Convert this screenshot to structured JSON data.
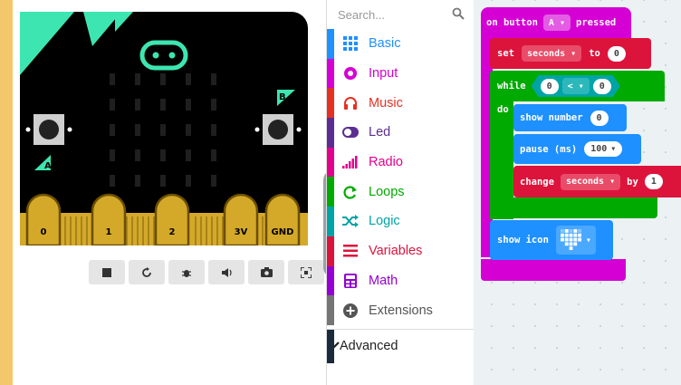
{
  "board": {
    "button_a": "A",
    "button_b": "B",
    "pins": [
      "0",
      "1",
      "2",
      "3V",
      "GND"
    ]
  },
  "sim_toolbar": {
    "buttons": [
      "stop-icon",
      "restart-icon",
      "debug-icon",
      "mute-icon",
      "screenshot-icon",
      "fullscreen-icon"
    ]
  },
  "search": {
    "placeholder": "Search..."
  },
  "categories": [
    {
      "label": "Basic",
      "color": "#1e90ff"
    },
    {
      "label": "Input",
      "color": "#d400d4"
    },
    {
      "label": "Music",
      "color": "#e63022"
    },
    {
      "label": "Led",
      "color": "#5c2d91"
    },
    {
      "label": "Radio",
      "color": "#e3008c"
    },
    {
      "label": "Loops",
      "color": "#00aa00"
    },
    {
      "label": "Logic",
      "color": "#00a4a6"
    },
    {
      "label": "Variables",
      "color": "#dc143c"
    },
    {
      "label": "Math",
      "color": "#9400d3"
    },
    {
      "label": "Extensions",
      "color": "#757575"
    }
  ],
  "advanced": {
    "label": "Advanced"
  },
  "blocks": {
    "on_button": {
      "prefix": "on button",
      "button": "A",
      "suffix": "pressed"
    },
    "set": {
      "prefix": "set",
      "variable": "seconds",
      "to": "to",
      "value": "0"
    },
    "while": {
      "label": "while",
      "left": "0",
      "op": "<",
      "right": "0",
      "do": "do"
    },
    "show_number": {
      "label": "show number",
      "value": "0"
    },
    "pause": {
      "label": "pause (ms)",
      "value": "100"
    },
    "change": {
      "label": "change",
      "variable": "seconds",
      "by": "by",
      "value": "1"
    },
    "show_icon": {
      "label": "show icon"
    }
  }
}
